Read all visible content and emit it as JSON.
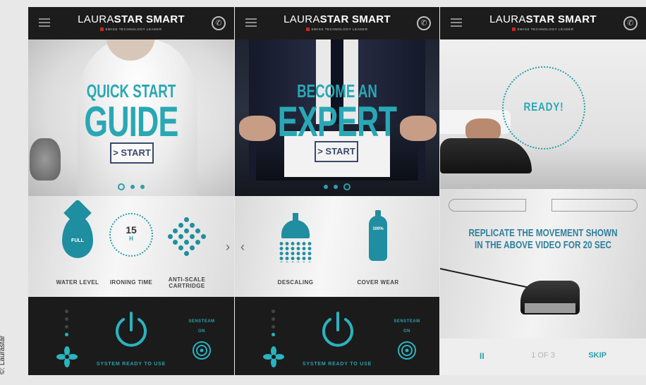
{
  "credit": "©: Laurastar",
  "brand": {
    "name_light": "LAURA",
    "name_bold": "STAR SMART",
    "tagline": "SWISS TECHNOLOGY LEADER"
  },
  "screens": [
    {
      "hero": {
        "line1": "QUICK START",
        "line2": "GUIDE",
        "button": "> START"
      },
      "features": [
        {
          "label": "WATER LEVEL",
          "value": "FULL"
        },
        {
          "label": "IRONING TIME",
          "value": "15",
          "unit": "H"
        },
        {
          "label": "ANTI-SCALE CARTRIDGE"
        }
      ],
      "bottom": {
        "status": "SYSTEM READY TO USE",
        "steam": "SENSTEAM ON"
      }
    },
    {
      "hero": {
        "line1": "BECOME AN",
        "line2": "EXPERT",
        "button": "> START"
      },
      "features": [
        {
          "label": "DESCALING"
        },
        {
          "label": "COVER WEAR",
          "value": "100%"
        }
      ],
      "bottom": {
        "status": "SYSTEM READY TO USE",
        "steam": "SENSTEAM ON"
      }
    },
    {
      "ready": "READY!",
      "instruction": "REPLICATE THE MOVEMENT SHOWN IN THE ABOVE VIDEO FOR 20 SEC",
      "footer": {
        "pause": "II",
        "pager": "1 OF 3",
        "skip": "SKIP"
      }
    }
  ],
  "colors": {
    "accent": "#2aa0ac",
    "topbar": "#1c1c1c",
    "bottom": "#1b1b1b"
  },
  "icons": [
    "menu-icon",
    "phone-icon",
    "water-drop-icon",
    "timer-icon",
    "cartridge-icon",
    "shower-icon",
    "bottle-icon",
    "fan-icon",
    "power-icon",
    "steam-icon"
  ]
}
